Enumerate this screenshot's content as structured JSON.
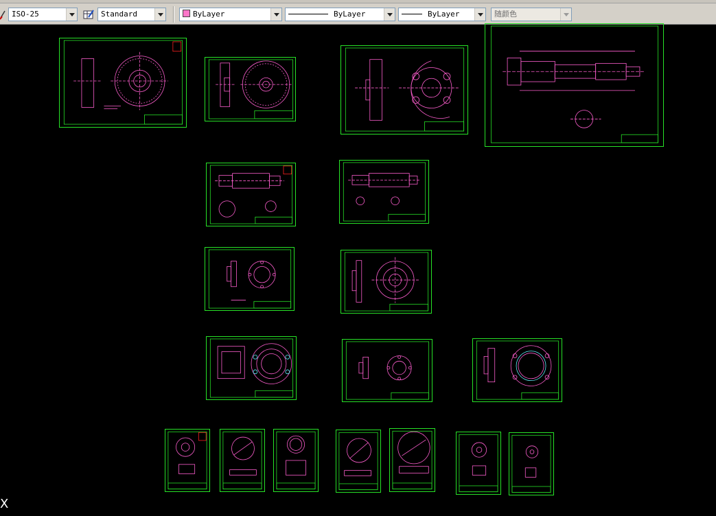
{
  "toolbar": {
    "dimstyle": {
      "value": "ISO-25",
      "icon": "dimstyle-icon"
    },
    "tablestyle": {
      "value": "Standard",
      "icon": "tablestyle-icon"
    },
    "layer_color": {
      "value": "ByLayer",
      "swatch": "#ff77c8"
    },
    "linetype": {
      "value": "ByLayer"
    },
    "lineweight": {
      "value": "ByLayer"
    },
    "plotstyle": {
      "value": "随颜色"
    }
  },
  "canvas": {
    "background": "#000000",
    "sheet_border_color": "#27e427",
    "drawing_line_color": "#ff5fd0",
    "cursor_glyph": "X"
  }
}
